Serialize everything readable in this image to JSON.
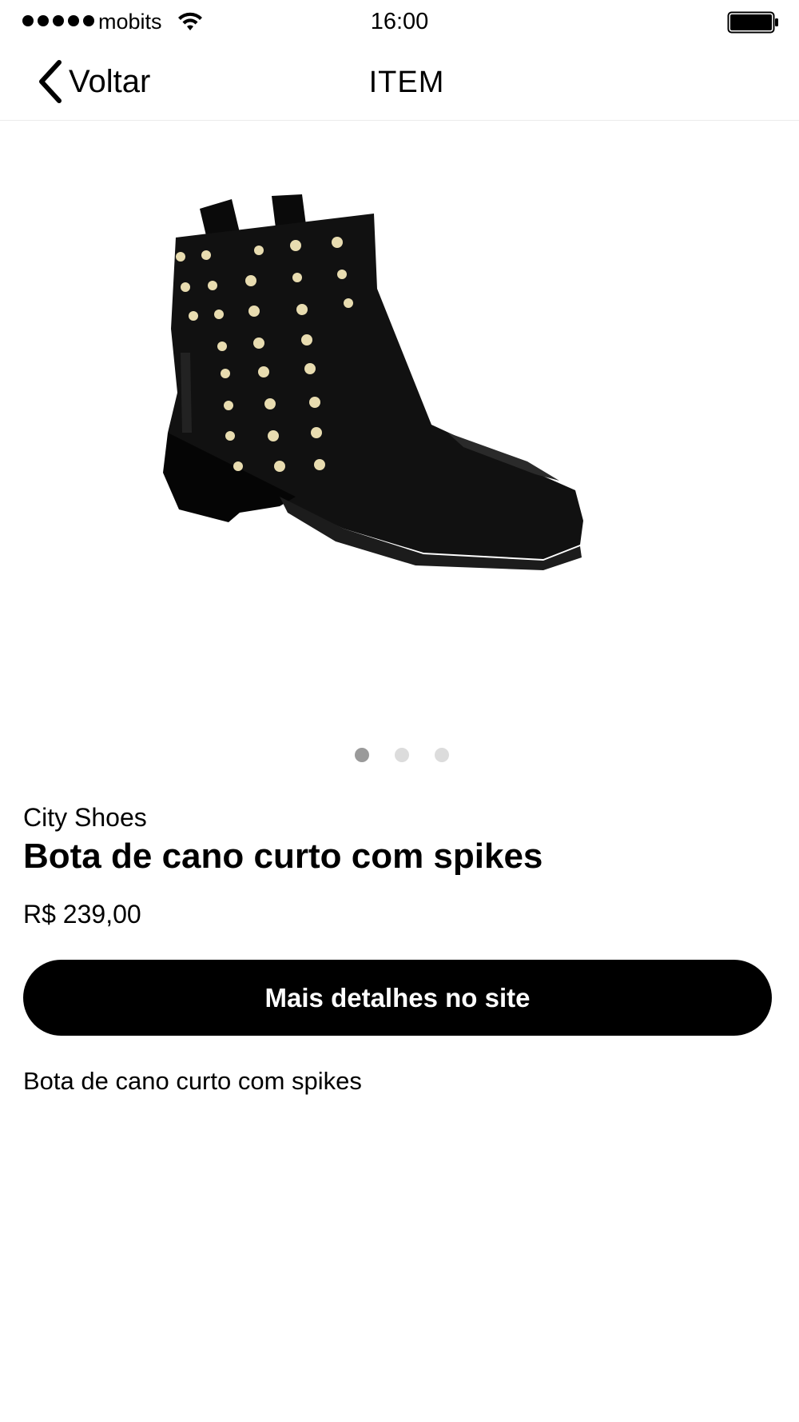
{
  "status_bar": {
    "carrier": "mobits",
    "time": "16:00",
    "icons": [
      "signal-dots-icon",
      "wifi-icon",
      "battery-icon"
    ]
  },
  "nav": {
    "back_label": "Voltar",
    "back_icon": "chevron-left-icon",
    "title": "ITEM"
  },
  "product": {
    "image_icon": "studded-ankle-boot-image",
    "carousel": {
      "pages": 3,
      "active_index": 0
    },
    "brand": "City Shoes",
    "name": "Bota de cano curto com spikes",
    "price": "R$ 239,00",
    "cta_label": "Mais detalhes no site",
    "description": "Bota de cano curto com spikes"
  },
  "colors": {
    "primary": "#000000",
    "background": "#ffffff",
    "dot_active": "#9a9a9a",
    "dot_inactive": "#dcdcdc"
  }
}
